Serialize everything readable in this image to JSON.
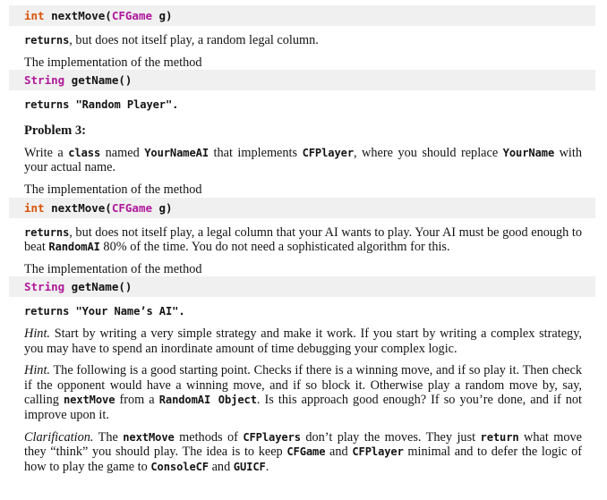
{
  "document": {
    "kind": "programming-assignment-handout",
    "colors": {
      "code_bar_background": "#f0f0f0",
      "keyword_type": "#d9540d",
      "keyword_class": "#b0189b",
      "body_text": "#141414",
      "page_background": "#ffffff"
    },
    "blocks": [
      {
        "id": "sig-nextmove-1",
        "type": "code_signature",
        "tokens": [
          {
            "text": "int",
            "style": "type"
          },
          {
            "text": " nextMove(",
            "style": "plain"
          },
          {
            "text": "CFGame",
            "style": "class"
          },
          {
            "text": " g)",
            "style": "plain"
          }
        ]
      },
      {
        "id": "para-returns-random-column",
        "type": "paragraph",
        "runs": [
          {
            "text": "returns",
            "style": "mono"
          },
          {
            "text": ", but does not itself play, a random legal column.",
            "style": "normal"
          }
        ]
      },
      {
        "id": "para-impl-1",
        "type": "paragraph",
        "runs": [
          {
            "text": "The implementation of the method",
            "style": "normal"
          }
        ]
      },
      {
        "id": "sig-getname-1",
        "type": "code_signature",
        "tokens": [
          {
            "text": "String",
            "style": "class"
          },
          {
            "text": " getName()",
            "style": "plain"
          }
        ]
      },
      {
        "id": "para-returns-random-player",
        "type": "paragraph",
        "runs": [
          {
            "text": "returns \"Random Player\".",
            "style": "mono-partial"
          }
        ]
      },
      {
        "id": "heading-problem-3",
        "type": "heading",
        "text": "Problem 3:"
      },
      {
        "id": "para-write-class",
        "type": "paragraph",
        "runs": [
          {
            "text": "Write a ",
            "style": "normal"
          },
          {
            "text": "class",
            "style": "mono"
          },
          {
            "text": " named ",
            "style": "normal"
          },
          {
            "text": "YourNameAI",
            "style": "mono"
          },
          {
            "text": " that implements ",
            "style": "normal"
          },
          {
            "text": "CFPlayer",
            "style": "mono"
          },
          {
            "text": ", where you should replace ",
            "style": "normal"
          },
          {
            "text": "YourName",
            "style": "mono"
          },
          {
            "text": " with your actual name.",
            "style": "normal"
          }
        ]
      },
      {
        "id": "para-impl-2",
        "type": "paragraph",
        "runs": [
          {
            "text": "The implementation of the method",
            "style": "normal"
          }
        ]
      },
      {
        "id": "sig-nextmove-2",
        "type": "code_signature",
        "tokens": [
          {
            "text": "int",
            "style": "type"
          },
          {
            "text": " nextMove(",
            "style": "plain"
          },
          {
            "text": "CFGame",
            "style": "class"
          },
          {
            "text": " g)",
            "style": "plain"
          }
        ]
      },
      {
        "id": "para-returns-ai-column",
        "type": "paragraph",
        "runs": [
          {
            "text": "returns",
            "style": "mono"
          },
          {
            "text": ", but does not itself play, a legal column that your AI wants to play. Your AI must be good enough to beat ",
            "style": "normal"
          },
          {
            "text": "RandomAI",
            "style": "mono"
          },
          {
            "text": " 80% of the time. You do not need a sophisticated algorithm for this.",
            "style": "normal"
          }
        ]
      },
      {
        "id": "para-impl-3",
        "type": "paragraph",
        "runs": [
          {
            "text": "The implementation of the method",
            "style": "normal"
          }
        ]
      },
      {
        "id": "sig-getname-2",
        "type": "code_signature",
        "tokens": [
          {
            "text": "String",
            "style": "class"
          },
          {
            "text": " getName()",
            "style": "plain"
          }
        ]
      },
      {
        "id": "para-returns-your-name-ai",
        "type": "paragraph",
        "runs": [
          {
            "text": "returns \"Your Name’s AI\".",
            "style": "mono-partial"
          }
        ]
      },
      {
        "id": "para-hint-1",
        "type": "paragraph",
        "runs": [
          {
            "text": "Hint.",
            "style": "italic"
          },
          {
            "text": " Start by writing a very simple strategy and make it work. If you start by writing a complex strategy, you may have to spend an inordinate amount of time debugging your complex logic.",
            "style": "normal"
          }
        ]
      },
      {
        "id": "para-hint-2",
        "type": "paragraph",
        "runs": [
          {
            "text": "Hint.",
            "style": "italic"
          },
          {
            "text": " The following is a good starting point. Checks if there is a winning move, and if so play it. Then check if the opponent would have a winning move, and if so block it. Otherwise play a random move by, say, calling ",
            "style": "normal"
          },
          {
            "text": "nextMove",
            "style": "mono"
          },
          {
            "text": " from a ",
            "style": "normal"
          },
          {
            "text": "RandomAI Object",
            "style": "mono"
          },
          {
            "text": ". Is this approach good enough? If so you’re done, and if not improve upon it.",
            "style": "normal"
          }
        ]
      },
      {
        "id": "para-clarification",
        "type": "paragraph",
        "runs": [
          {
            "text": "Clarification.",
            "style": "italic"
          },
          {
            "text": " The ",
            "style": "normal"
          },
          {
            "text": "nextMove",
            "style": "mono"
          },
          {
            "text": " methods of ",
            "style": "normal"
          },
          {
            "text": "CFPlayers",
            "style": "mono"
          },
          {
            "text": " don’t play the moves. They just ",
            "style": "normal"
          },
          {
            "text": "return",
            "style": "mono"
          },
          {
            "text": " what move they “think” you should play. The idea is to keep ",
            "style": "normal"
          },
          {
            "text": "CFGame",
            "style": "mono"
          },
          {
            "text": " and ",
            "style": "normal"
          },
          {
            "text": "CFPlayer",
            "style": "mono"
          },
          {
            "text": " minimal and to defer the logic of how to play the game to ",
            "style": "normal"
          },
          {
            "text": "ConsoleCF",
            "style": "mono"
          },
          {
            "text": " and ",
            "style": "normal"
          },
          {
            "text": "GUICF",
            "style": "mono"
          },
          {
            "text": ".",
            "style": "normal"
          }
        ]
      }
    ]
  }
}
